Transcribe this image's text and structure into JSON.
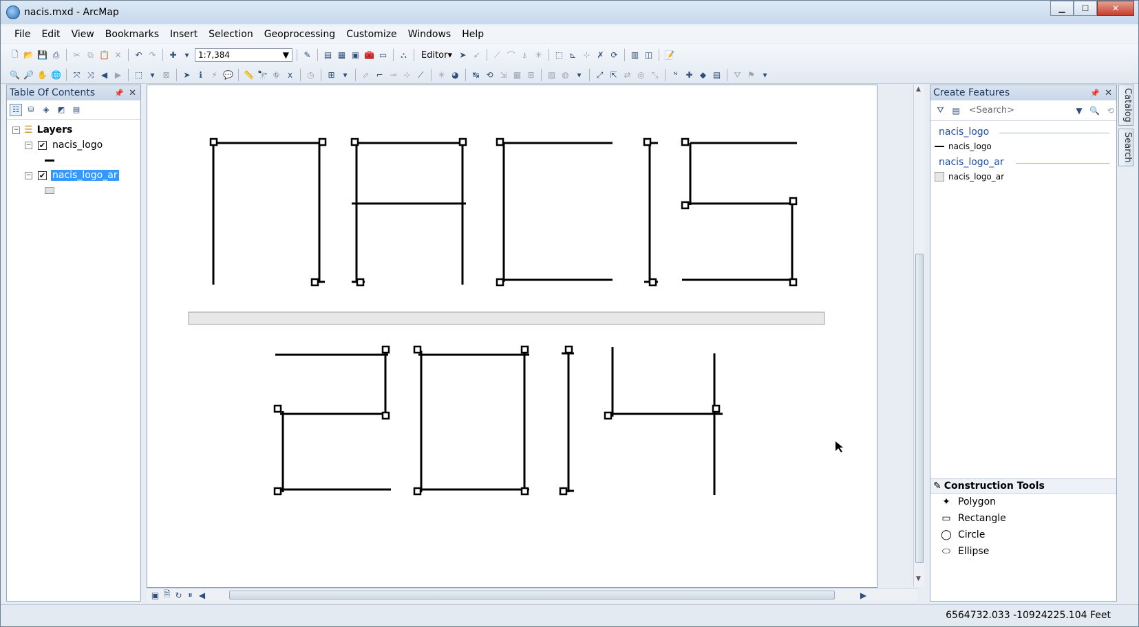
{
  "window": {
    "title": "nacis.mxd - ArcMap"
  },
  "window_buttons": {
    "minimize": "▁",
    "maximize": "☐",
    "close": "✕"
  },
  "menu": [
    "File",
    "Edit",
    "View",
    "Bookmarks",
    "Insert",
    "Selection",
    "Geoprocessing",
    "Customize",
    "Windows",
    "Help"
  ],
  "standard_toolbar": {
    "scale": "1:7,384",
    "editor_label": "Editor"
  },
  "toc": {
    "title": "Table Of Contents",
    "root": "Layers",
    "layers": [
      {
        "name": "nacis_logo",
        "checked": true,
        "symbol": "line"
      },
      {
        "name": "nacis_logo_ar",
        "checked": true,
        "symbol": "polygon",
        "selected": true
      }
    ]
  },
  "create_features": {
    "title": "Create Features",
    "search_placeholder": "<Search>",
    "groups": [
      {
        "name": "nacis_logo",
        "item": "nacis_logo"
      },
      {
        "name": "nacis_logo_ar",
        "item": "nacis_logo_ar"
      }
    ]
  },
  "construction_tools": {
    "title": "Construction Tools",
    "items": [
      "Polygon",
      "Rectangle",
      "Circle",
      "Ellipse"
    ]
  },
  "side_tabs": [
    "Catalog",
    "Search"
  ],
  "status": {
    "coordinates": "6564732.033  -10924225.104 Feet"
  }
}
